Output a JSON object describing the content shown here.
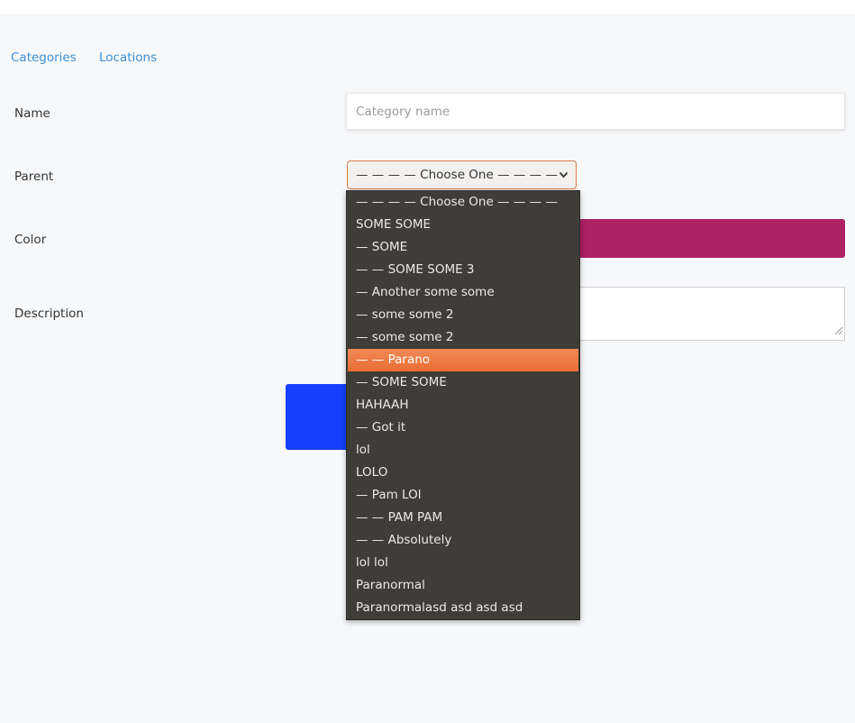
{
  "nav": {
    "categories": "Categories",
    "locations": "Locations"
  },
  "form": {
    "name_label": "Name",
    "name_placeholder": "Category name",
    "parent_label": "Parent",
    "parent_selected": "— — — — Choose One — — — —",
    "color_label": "Color",
    "color_value": "#ac2164",
    "description_label": "Description"
  },
  "dropdown": {
    "selected_index": 7,
    "options": [
      "— — — — Choose One — — — —",
      "SOME SOME",
      "— SOME",
      "— — SOME SOME 3",
      "— Another some some",
      "— some some 2",
      "— some some 2",
      "— — Parano",
      "— SOME SOME",
      "HAHAAH",
      "— Got it",
      "lol",
      "LOLO",
      "— Pam LOl",
      "— — PAM PAM",
      "— — Absolutely",
      "lol lol",
      "Paranormal",
      "Paranormalasd asd asd asd"
    ]
  },
  "colors": {
    "link": "#3a8fd6",
    "accent_orange": "#e96e35",
    "color_swatch": "#ac2164",
    "submit_button": "#1440ff",
    "dropdown_bg": "#3f3d38"
  },
  "icons": {
    "select_arrow": "chevron-down-icon",
    "resize_handle": "resize-grip-icon"
  }
}
